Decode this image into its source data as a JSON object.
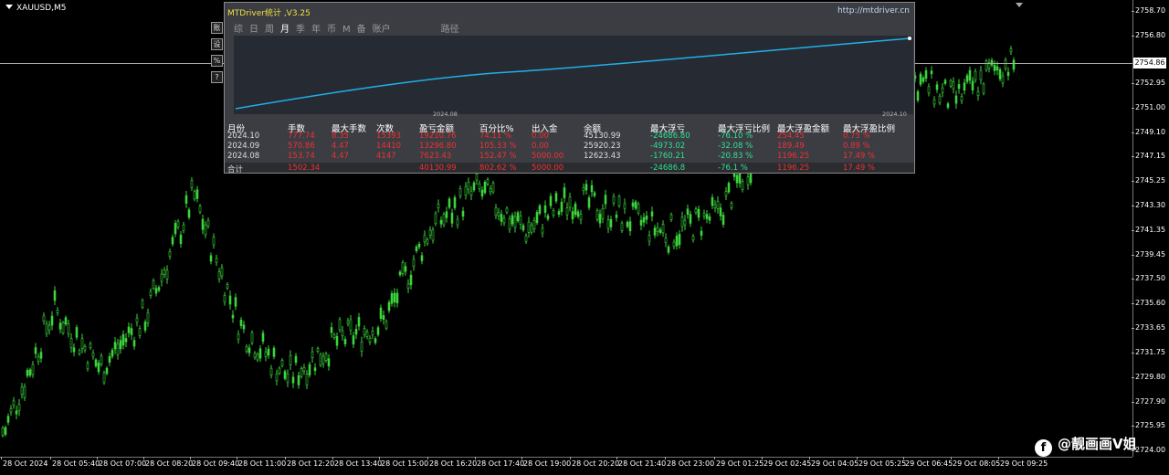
{
  "symbol": "XAUUSD,M5",
  "panel": {
    "title": "MTDriver统计 ,V3.25",
    "url": "http://mtdriver.cn",
    "tabs": [
      "综",
      "日",
      "周",
      "月",
      "季",
      "年",
      "币",
      "M",
      "备",
      "账户"
    ],
    "active_tab": "月",
    "route_tab": "路径",
    "graph_dates": [
      "2024.08",
      "2024.10"
    ],
    "headers": [
      "月份",
      "手数",
      "最大手数",
      "次数",
      "盈亏金额",
      "百分比%",
      "出入金",
      "余额",
      "最大浮亏",
      "最大浮亏比例",
      "最大浮盈金额",
      "最大浮盈比例"
    ],
    "rows": [
      [
        "2024.10",
        "777.74",
        "8.35",
        "15393",
        "19210.76",
        "74.11 %",
        "0.00",
        "45130.99",
        "-24686.80",
        "-76.10 %",
        "254.45",
        "0.75 %"
      ],
      [
        "2024.09",
        "570.86",
        "4.47",
        "14410",
        "13296.80",
        "105.33 %",
        "0.00",
        "25920.23",
        "-4973.02",
        "-32.08 %",
        "189.49",
        "0.89 %"
      ],
      [
        "2024.08",
        "153.74",
        "4.47",
        "4147",
        "7623.43",
        "152.47 %",
        "5000.00",
        "12623.43",
        "-1760.21",
        "-20.83 %",
        "1196.25",
        "17.49 %"
      ]
    ],
    "total": [
      "合计",
      "1502.34",
      "",
      "",
      "40130.99",
      "802.62 %",
      "5000.00",
      "",
      "-24686.8",
      "-76.1 %",
      "1196.25",
      "17.49 %"
    ]
  },
  "side_buttons": [
    "账",
    "设",
    "%",
    "?"
  ],
  "price_axis": {
    "current_price": "2754.86",
    "labels": [
      "2758.70",
      "2756.80",
      "2752.95",
      "2751.00",
      "2749.10",
      "2747.15",
      "2745.25",
      "2743.30",
      "2741.35",
      "2739.45",
      "2737.50",
      "2735.60",
      "2733.65",
      "2731.75",
      "2729.80",
      "2727.90",
      "2725.95",
      "2724.00"
    ]
  },
  "time_axis": [
    "28 Oct 2024",
    "28 Oct 05:40",
    "28 Oct 07:00",
    "28 Oct 08:20",
    "28 Oct 09:40",
    "28 Oct 11:00",
    "28 Oct 12:20",
    "28 Oct 13:40",
    "28 Oct 15:00",
    "28 Oct 16:20",
    "28 Oct 17:40",
    "28 Oct 19:00",
    "28 Oct 20:20",
    "28 Oct 21:40",
    "28 Oct 23:00",
    "29 Oct 01:25",
    "29 Oct 02:45",
    "29 Oct 04:05",
    "29 Oct 05:25",
    "29 Oct 06:45",
    "29 Oct 08:05",
    "29 Oct 09:25"
  ],
  "chart_data": {
    "type": "line",
    "series": [
      {
        "x": [
          "28 Oct 2024",
          "28 Oct 05:40",
          "28 Oct 07:00",
          "28 Oct 08:20",
          "28 Oct 09:40",
          "28 Oct 11:00",
          "28 Oct 12:20",
          "28 Oct 13:40",
          "28 Oct 15:00",
          "28 Oct 16:20",
          "28 Oct 17:40",
          "28 Oct 19:00",
          "28 Oct 20:20",
          "28 Oct 21:40",
          "28 Oct 23:00",
          "29 Oct 01:25",
          "29 Oct 02:45",
          "29 Oct 04:05",
          "29 Oct 05:25",
          "29 Oct 06:45",
          "29 Oct 08:05",
          "29 Oct 09:25"
        ],
        "values": [
          2725.5,
          2735.2,
          2730.5,
          2734.8,
          2744.2,
          2733.8,
          2729.8,
          2732.6,
          2734.0,
          2741.6,
          2744.6,
          2741.4,
          2743.9,
          2742.6,
          2741.1,
          2742.6,
          2748.6,
          2752.6,
          2754.0,
          2753.6,
          2751.6,
          2754.5
        ]
      }
    ],
    "ylim": [
      2724.0,
      2758.7
    ],
    "colors": {
      "candle": "#3cd43c",
      "equity_line": "#20b0e8"
    }
  },
  "watermark": {
    "icon": "f",
    "text": "@靓画画V姐"
  }
}
